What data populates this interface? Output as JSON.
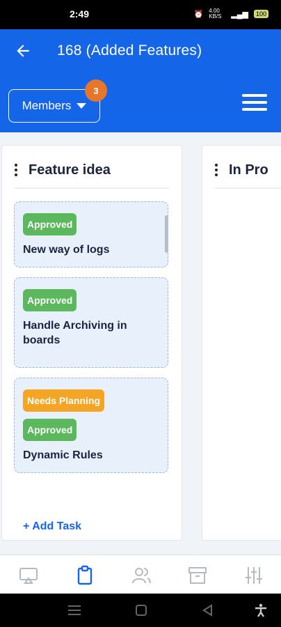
{
  "status_bar": {
    "time": "2:49",
    "icons_text": "4.00 KB/S",
    "battery": "100"
  },
  "app_bar": {
    "title": "168 (Added Features)",
    "back_icon": "arrow-left-icon"
  },
  "toolbar": {
    "members_label": "Members",
    "members_count": "3",
    "menu_icon": "hamburger-icon"
  },
  "columns": [
    {
      "title": "Feature idea",
      "cards": [
        {
          "tags": [
            {
              "label": "Approved",
              "color": "#5cb85c"
            }
          ],
          "title": "New way of logs"
        },
        {
          "tags": [
            {
              "label": "Approved",
              "color": "#5cb85c"
            }
          ],
          "title": "Handle Archiving in boards"
        },
        {
          "tags": [
            {
              "label": "Needs Planning",
              "color": "#f5a524"
            },
            {
              "label": "Approved",
              "color": "#5cb85c"
            }
          ],
          "title": "Dynamic Rules"
        }
      ],
      "add_task_label": "+ Add Task"
    },
    {
      "title": "In Pro"
    }
  ],
  "bottom_nav": [
    "presentation-icon",
    "clipboard-icon",
    "users-icon",
    "archive-icon",
    "sliders-icon"
  ],
  "accent_color": "#1565e8"
}
